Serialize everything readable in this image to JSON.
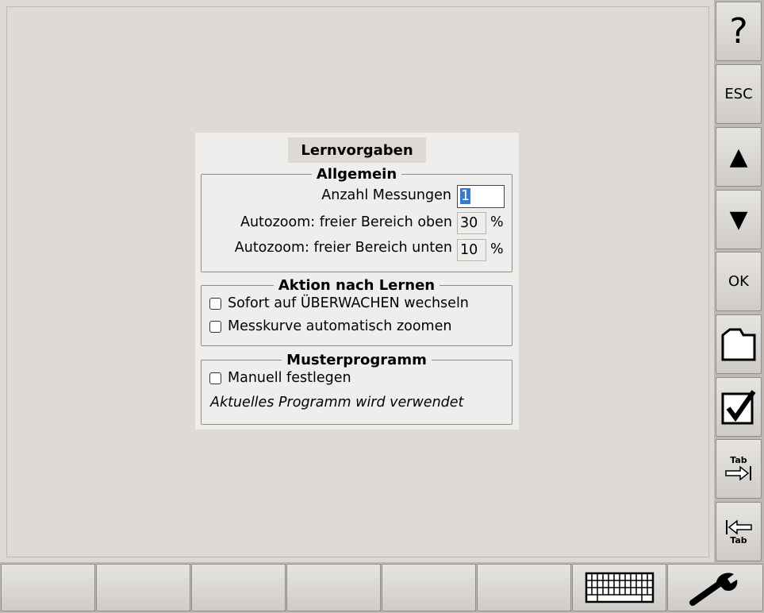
{
  "side_buttons": {
    "help": "?",
    "esc": "ESC",
    "up": "▲",
    "down": "▼",
    "ok": "OK",
    "tab_forward_label": "Tab",
    "tab_back_label": "Tab"
  },
  "dialog": {
    "title": "Lernvorgaben",
    "general": {
      "legend": "Allgemein",
      "measurements_label": "Anzahl Messungen",
      "measurements_value": "1",
      "zoom_top_label": "Autozoom: freier Bereich oben",
      "zoom_top_value": "30",
      "zoom_top_unit": "%",
      "zoom_bottom_label": "Autozoom: freier Bereich unten",
      "zoom_bottom_value": "10",
      "zoom_bottom_unit": "%"
    },
    "action": {
      "legend": "Aktion nach Lernen",
      "switch_monitor_label": "Sofort auf ÜBERWACHEN wechseln",
      "switch_monitor_checked": false,
      "auto_zoom_label": "Messkurve automatisch zoomen",
      "auto_zoom_checked": false
    },
    "pattern": {
      "legend": "Musterprogramm",
      "manual_label": "Manuell festlegen",
      "manual_checked": false,
      "info_text": "Aktuelles Programm wird verwendet"
    }
  }
}
